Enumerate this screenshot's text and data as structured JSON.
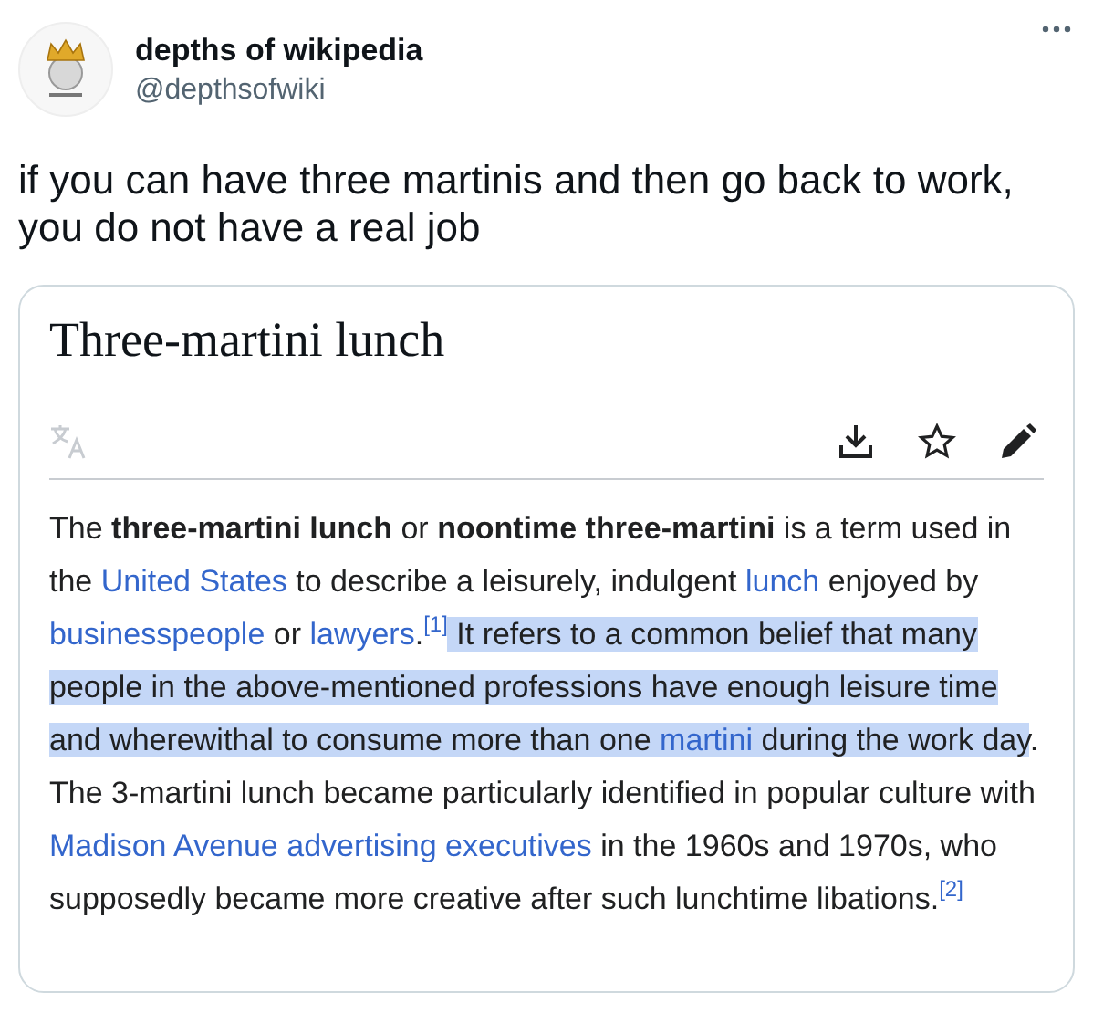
{
  "tweet": {
    "display_name": "depths of wikipedia",
    "handle": "@depthsofwiki",
    "text": "if you can have three martinis and then go back to work, you do not have a real job"
  },
  "article": {
    "title": "Three-martini lunch",
    "paragraph": [
      {
        "kind": "text",
        "text": "The ",
        "highlighted": false
      },
      {
        "kind": "bold",
        "text": "three-martini lunch",
        "highlighted": false
      },
      {
        "kind": "text",
        "text": " or ",
        "highlighted": false
      },
      {
        "kind": "bold",
        "text": "noontime three-martini",
        "highlighted": false
      },
      {
        "kind": "text",
        "text": " is a term used in the ",
        "highlighted": false
      },
      {
        "kind": "link",
        "text": "United States",
        "highlighted": false
      },
      {
        "kind": "text",
        "text": " to describe a leisurely, indulgent ",
        "highlighted": false
      },
      {
        "kind": "link",
        "text": "lunch",
        "highlighted": false
      },
      {
        "kind": "text",
        "text": " enjoyed by ",
        "highlighted": false
      },
      {
        "kind": "link",
        "text": "businesspeople",
        "highlighted": false
      },
      {
        "kind": "text",
        "text": " or ",
        "highlighted": false
      },
      {
        "kind": "link",
        "text": "lawyers",
        "highlighted": false
      },
      {
        "kind": "text",
        "text": ".",
        "highlighted": false
      },
      {
        "kind": "ref",
        "text": "[1]",
        "highlighted": false
      },
      {
        "kind": "text",
        "text": " It refers to a common belief that many people in the above-mentioned professions have enough leisure time and wherewithal to consume more than one ",
        "highlighted": true
      },
      {
        "kind": "link",
        "text": "martini",
        "highlighted": true
      },
      {
        "kind": "text",
        "text": " during the work day",
        "highlighted": true
      },
      {
        "kind": "text",
        "text": ". The 3-martini lunch became particularly identified in popular culture with ",
        "highlighted": false
      },
      {
        "kind": "link",
        "text": "Madison Avenue advertising executives",
        "highlighted": false
      },
      {
        "kind": "text",
        "text": " in the 1960s and 1970s, who supposedly became more creative after such lunchtime libations.",
        "highlighted": false
      },
      {
        "kind": "ref",
        "text": "[2]",
        "highlighted": false
      }
    ]
  }
}
